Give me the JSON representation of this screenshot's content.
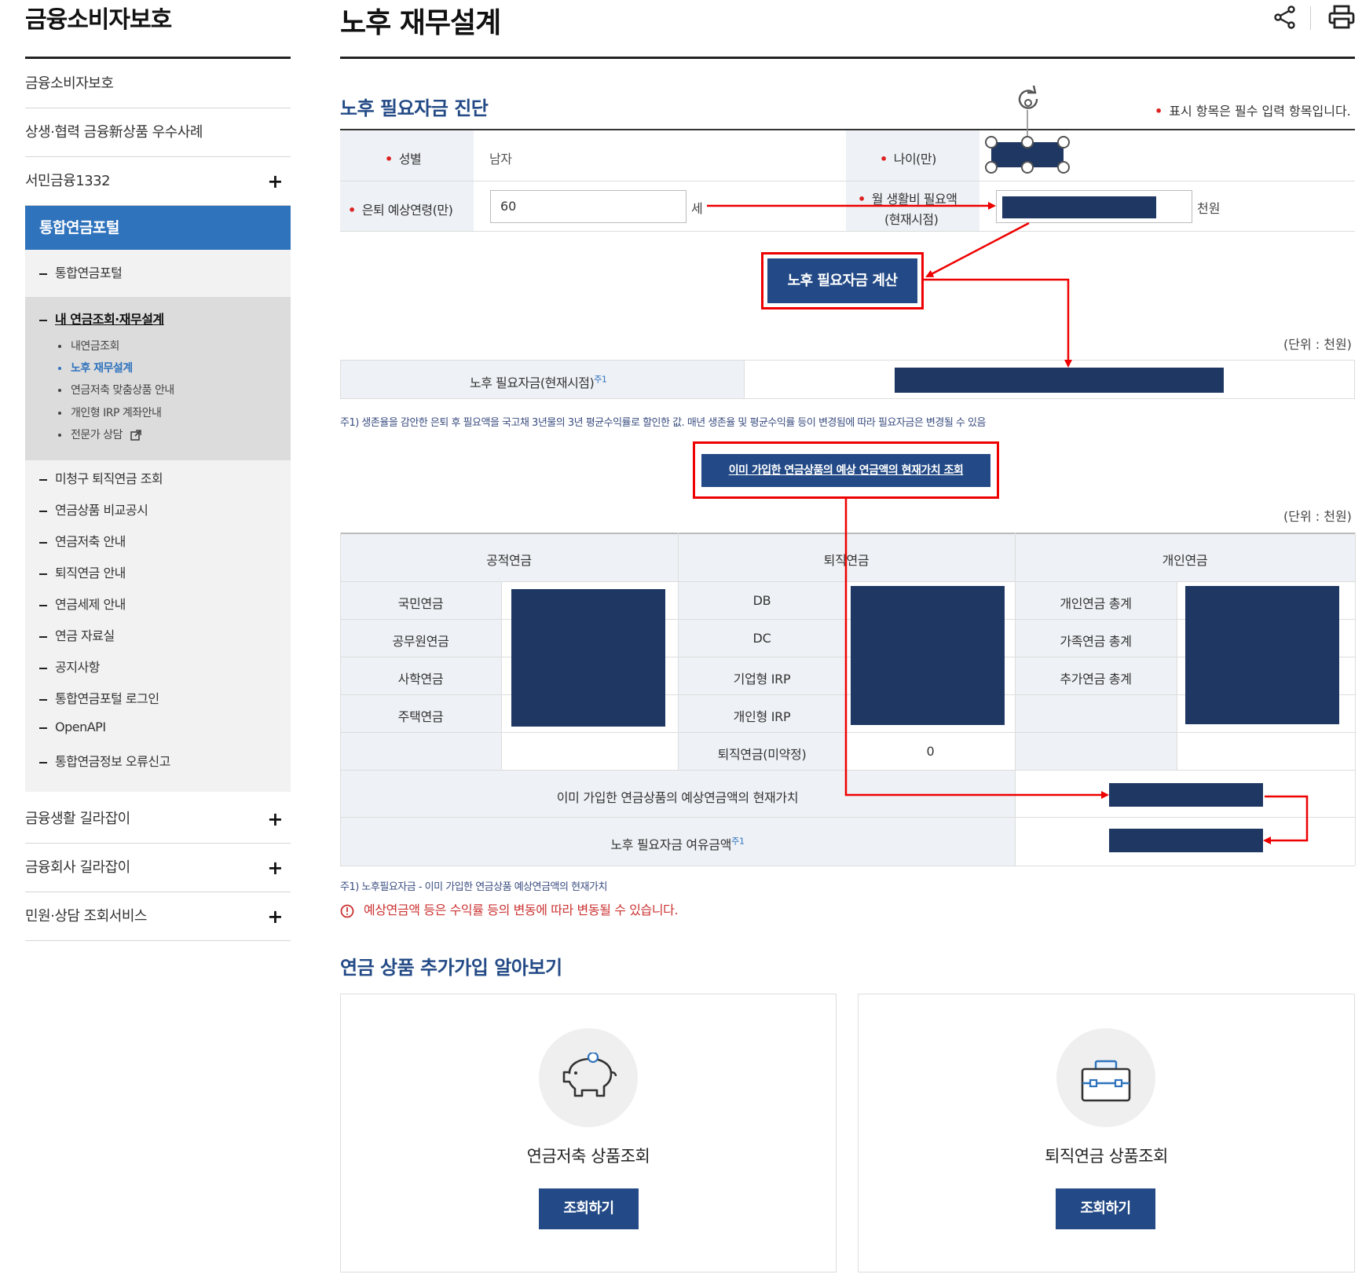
{
  "sidebar": {
    "title": "금융소비자보호",
    "top_items": [
      {
        "label": "금융소비자보호"
      },
      {
        "label": "상생·협력 금융新상품 우수사례"
      },
      {
        "label": "서민금융1332",
        "expand": "+"
      }
    ],
    "active": "통합연금포털",
    "sub_items": [
      {
        "label": "통합연금포털"
      },
      {
        "label": "내 연금조회·재무설계"
      }
    ],
    "level3": [
      {
        "label": "내연금조회"
      },
      {
        "label": "노후 재무설계"
      },
      {
        "label": "연금저축 맞춤상품 안내"
      },
      {
        "label": "개인형 IRP 계좌안내"
      },
      {
        "label": "전문가 상담"
      }
    ],
    "more_sub_items": [
      {
        "label": "미청구 퇴직연금 조회"
      },
      {
        "label": "연금상품 비교공시"
      },
      {
        "label": "연금저축 안내"
      },
      {
        "label": "퇴직연금 안내"
      },
      {
        "label": "연금세제 안내"
      },
      {
        "label": "연금 자료실"
      },
      {
        "label": "공지사항"
      },
      {
        "label": "통합연금포털 로그인"
      },
      {
        "label": "OpenAPI"
      },
      {
        "label": "통합연금정보 오류신고"
      }
    ],
    "bottom_items": [
      {
        "label": "금융생활 길라잡이",
        "expand": "+"
      },
      {
        "label": "금융회사 길라잡이",
        "expand": "+"
      },
      {
        "label": "민원·상담 조회서비스",
        "expand": "+"
      }
    ]
  },
  "page": {
    "title": "노후 재무설계",
    "icons": [
      "share-icon",
      "print-icon"
    ]
  },
  "diagnosis": {
    "heading": "노후 필요자금 진단",
    "required_note": "표시 항목은 필수 입력 항목입니다.",
    "gender_label": "성별",
    "gender_value": "남자",
    "age_label": "나이(만)",
    "retire_age_label": "은퇴 예상연령(만)",
    "retire_age_value": "60",
    "retire_age_unit": "세",
    "living_cost_label_1": "월 생활비 필요액",
    "living_cost_label_2": "(현재시점)",
    "living_cost_unit": "천원",
    "calc_button": "노후 필요자금 계산",
    "unit_note": "(단위 : 천원)",
    "result_label": "노후 필요자금(현재시점)",
    "result_sup": "주1",
    "footnote": "주1) 생존율을 감안한 은퇴 후 필요액을 국고채 3년물의 3년 평균수익률로 할인한 값. 매년 생존율 및 평균수익률 등이 변경됨에 따라 필요자금은 변경될 수 있음",
    "lookup_button": "이미 가입한 연금상품의 예상 연금액의 현재가치 조회"
  },
  "pension_table": {
    "unit_note": "(단위 : 천원)",
    "headers": [
      "공적연금",
      "퇴직연금",
      "개인연금"
    ],
    "public": [
      "국민연금",
      "공무원연금",
      "사학연금",
      "주택연금"
    ],
    "retirement": [
      "DB",
      "DC",
      "기업형 IRP",
      "개인형 IRP",
      "퇴직연금(미약정)"
    ],
    "retirement_unset_value": "0",
    "personal": [
      "개인연금 총계",
      "가족연금 총계",
      "추가연금 총계"
    ],
    "present_value_label": "이미 가입한 연금상품의 예상연금액의 현재가치",
    "surplus_label": "노후 필요자금 여유금액",
    "surplus_sup": "주1",
    "footnote": "주1) 노후필요자금 - 이미 가입한 연금상품 예상연금액의 현재가치",
    "warning": "예상연금액 등은 수익률 등의 변동에 따라 변동될 수 있습니다."
  },
  "additional": {
    "heading": "연금 상품 추가가입 알아보기",
    "cards": [
      {
        "title": "연금저축 상품조회",
        "button": "조회하기",
        "icon": "piggy-bank-icon"
      },
      {
        "title": "퇴직연금 상품조회",
        "button": "조회하기",
        "icon": "briefcase-icon"
      }
    ]
  },
  "colors": {
    "navy": "#1f3763",
    "accent_blue": "#2f73bd",
    "annotation_red": "#e00000",
    "heading_blue": "#234a86"
  }
}
